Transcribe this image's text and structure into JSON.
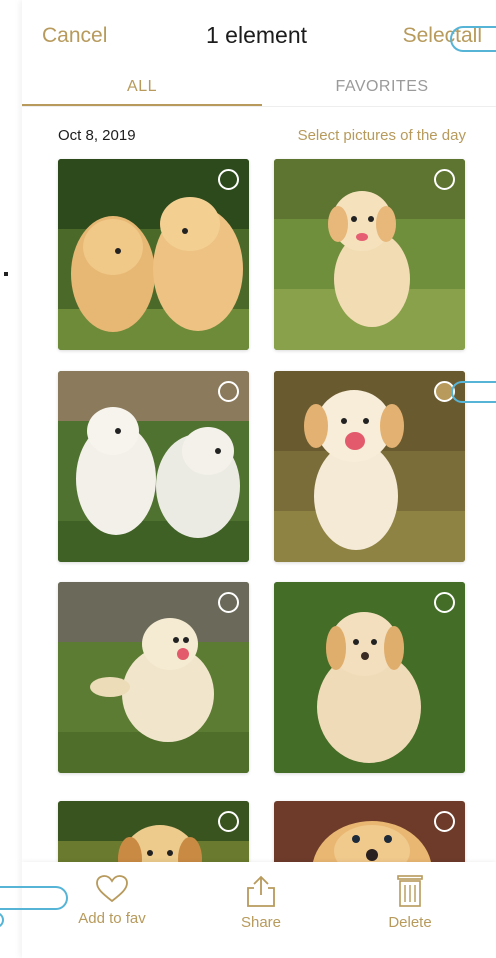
{
  "header": {
    "cancel_label": "Cancel",
    "title": "1 element",
    "select_all_prefix": "Select",
    "select_all_suffix": "all"
  },
  "tabs": [
    {
      "label": "ALL",
      "active": true
    },
    {
      "label": "FAVORITES",
      "active": false
    }
  ],
  "gallery": {
    "date": "Oct 8, 2019",
    "day_link": "Select pictures of the day",
    "photos": [
      {
        "name": "two puppies running",
        "selected": false
      },
      {
        "name": "puppy walking on grass",
        "selected": false
      },
      {
        "name": "two white puppies",
        "selected": false
      },
      {
        "name": "puppy running toward camera",
        "selected": true
      },
      {
        "name": "puppy jumping",
        "selected": false
      },
      {
        "name": "puppy sitting on grass",
        "selected": false
      },
      {
        "name": "puppy portrait",
        "selected": false
      },
      {
        "name": "puppy close-up",
        "selected": false
      }
    ]
  },
  "bottom_bar": {
    "add_fav_label": "Add to fav",
    "share_label": "Share",
    "delete_label": "Delete"
  },
  "icons": [
    "heart-icon",
    "share-icon",
    "trash-icon",
    "checkbox-icon"
  ],
  "colors": {
    "accent": "#b79a5c",
    "callout": "#56b4d6",
    "text": "#1c1c1c"
  }
}
